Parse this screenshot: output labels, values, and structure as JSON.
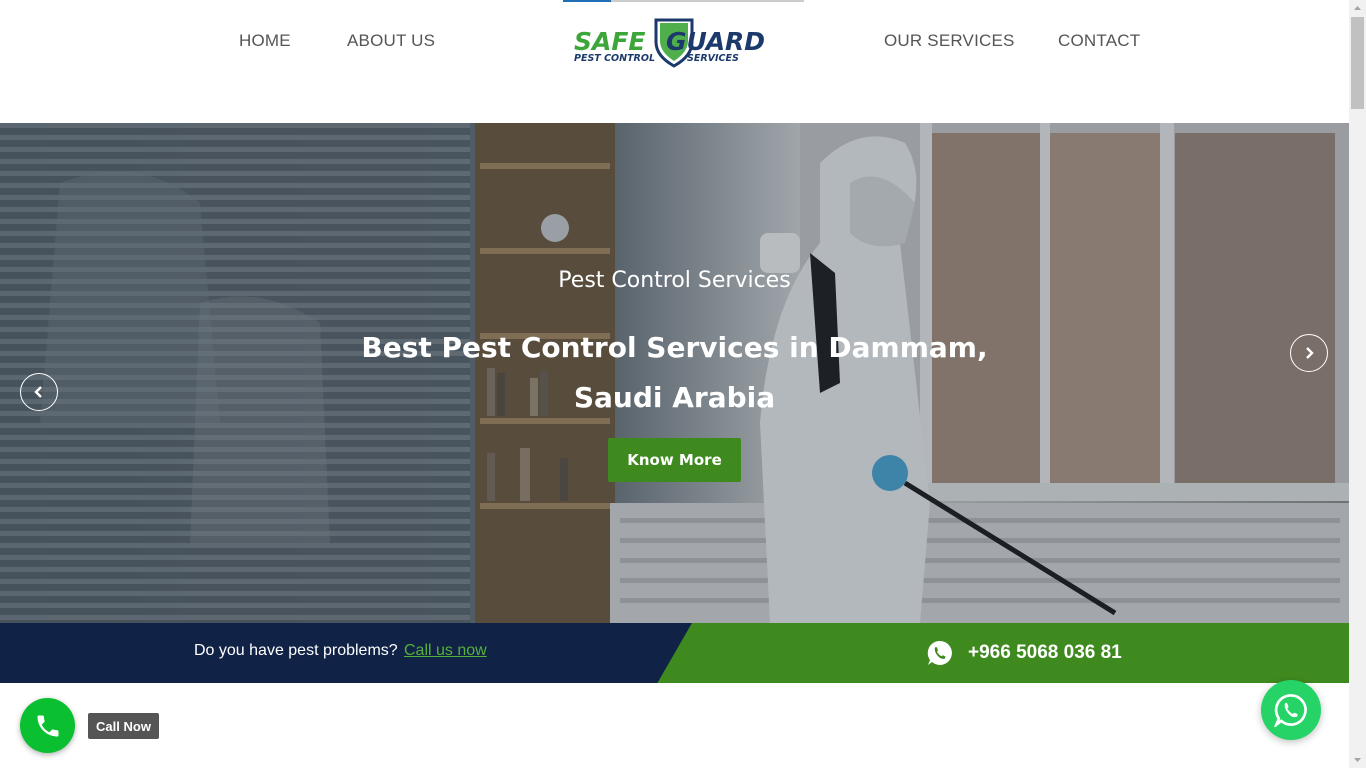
{
  "nav": {
    "home": "HOME",
    "about": "ABOUT US",
    "services": "OUR SERVICES",
    "contact": "CONTACT"
  },
  "logo": {
    "word1": "SAFE",
    "word2": "GUARD",
    "tagline1": "PEST CONTROL",
    "tagline2": "SERVICES",
    "green": "#3da63a",
    "navy": "#1b3a6b"
  },
  "hero": {
    "subtitle": "Pest Control Services",
    "title_line1": "Best Pest Control Services in Dammam,",
    "title_line2": "Saudi Arabia",
    "button": "Know More",
    "prev_icon": "chevron-left-icon",
    "next_icon": "chevron-right-icon"
  },
  "callbar": {
    "question": "Do you have pest problems?",
    "link": "Call us now",
    "phone": "+966 5068 036 81",
    "icon": "whatsapp-icon"
  },
  "floating": {
    "call_label": "Call Now",
    "call_icon": "phone-icon",
    "whatsapp_icon": "whatsapp-icon"
  },
  "colors": {
    "brand_green": "#3f8a1f",
    "navy": "#102246",
    "call_green": "#0abf30",
    "whatsapp": "#25d366"
  }
}
